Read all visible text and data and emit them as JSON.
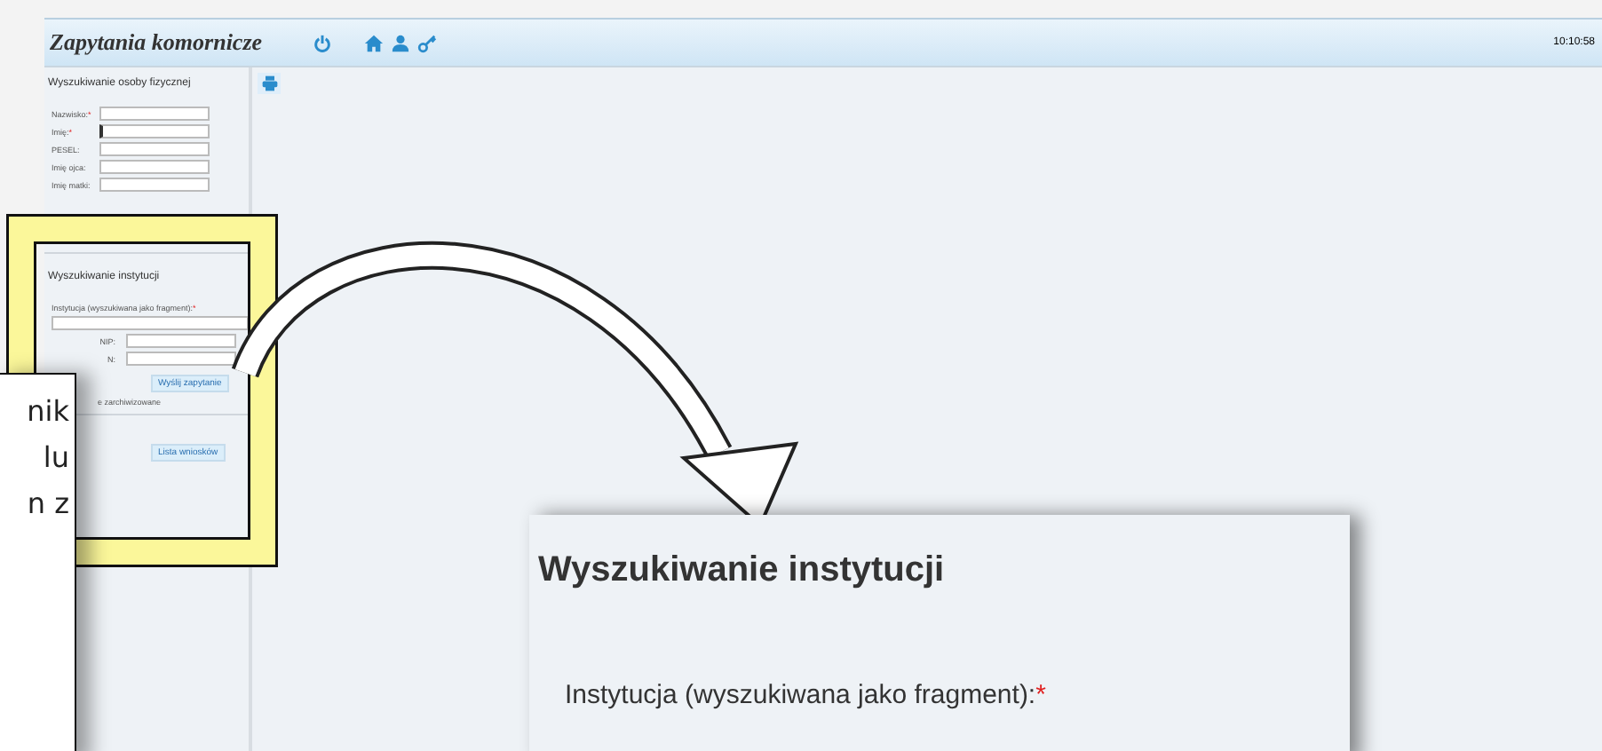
{
  "header": {
    "title": "Zapytania komornicze",
    "time": "10:10:58"
  },
  "sidebar": {
    "person_search": {
      "title": "Wyszukiwanie osoby fizycznej",
      "fields": [
        {
          "label": "Nazwisko:",
          "required_mark": "*",
          "focused": false
        },
        {
          "label": "Imię:",
          "required_mark": "*",
          "focused": true
        },
        {
          "label": "PESEL:",
          "focused": false
        },
        {
          "label": "Imię ojca:",
          "focused": false
        },
        {
          "label": "Imię matki:",
          "focused": false
        }
      ]
    },
    "institution_search": {
      "title": "Wyszukiwanie instytucji",
      "institution_label": "Instytucja (wyszukiwana jako fragment):",
      "institution_required_mark": "*",
      "fields": [
        {
          "label": "NIP:"
        },
        {
          "label": "N:"
        }
      ],
      "submit_button": "Wyślij zapytanie",
      "archived_option": "e zarchiwizowane",
      "list_button": "Lista wniosków"
    }
  },
  "callout": {
    "lines": [
      "nik",
      "lu",
      "n z"
    ]
  },
  "zoom_panel": {
    "title": "Wyszukiwanie instytucji",
    "label": "Instytucja (wyszukiwana jako fragment):",
    "required_mark": "*"
  }
}
